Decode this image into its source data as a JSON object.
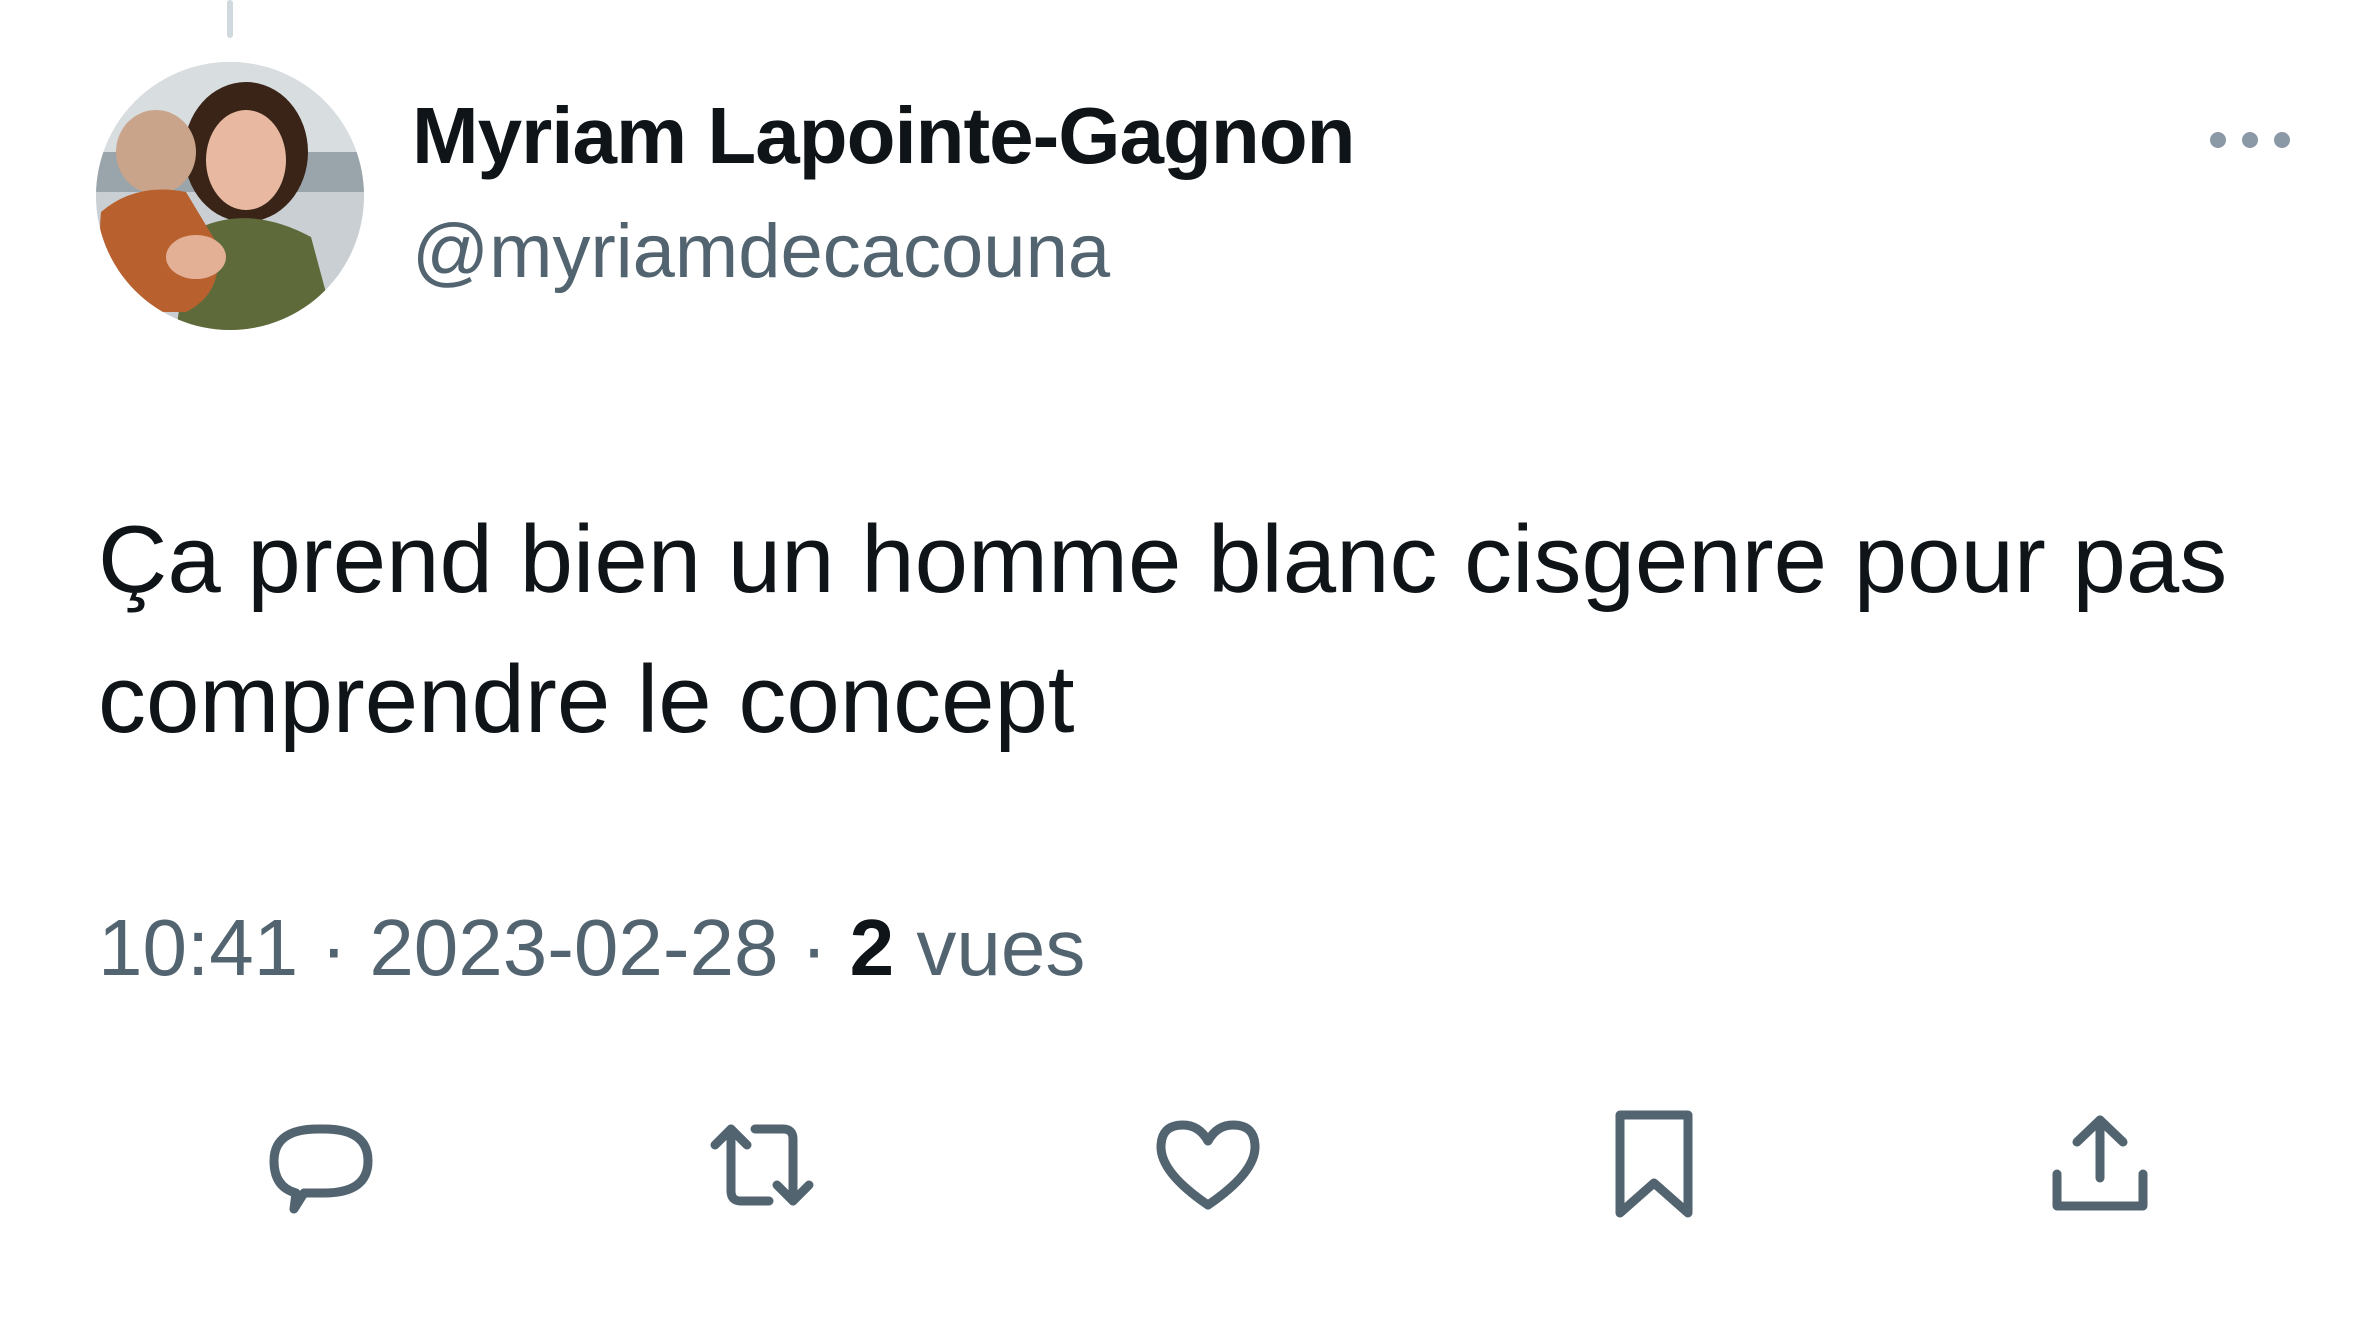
{
  "author": {
    "display_name": "Myriam Lapointe-Gagnon",
    "handle": "@myriamdecacouna",
    "avatar_icon": "profile-photo"
  },
  "tweet": {
    "text": "Ça prend bien un homme blanc cisgenre pour pas comprendre le concept"
  },
  "meta": {
    "time": "10:41",
    "separator": "·",
    "date": "2023-02-28",
    "views_count": "2",
    "views_label": "vues"
  },
  "actions": [
    {
      "name": "reply",
      "icon": "reply-icon"
    },
    {
      "name": "retweet",
      "icon": "retweet-icon"
    },
    {
      "name": "like",
      "icon": "heart-icon"
    },
    {
      "name": "bookmark",
      "icon": "bookmark-icon"
    },
    {
      "name": "share",
      "icon": "share-icon"
    }
  ],
  "colors": {
    "primary_text": "#0f1419",
    "secondary_text": "#536471",
    "icon": "#536471",
    "thread_line": "#cfd9de"
  }
}
